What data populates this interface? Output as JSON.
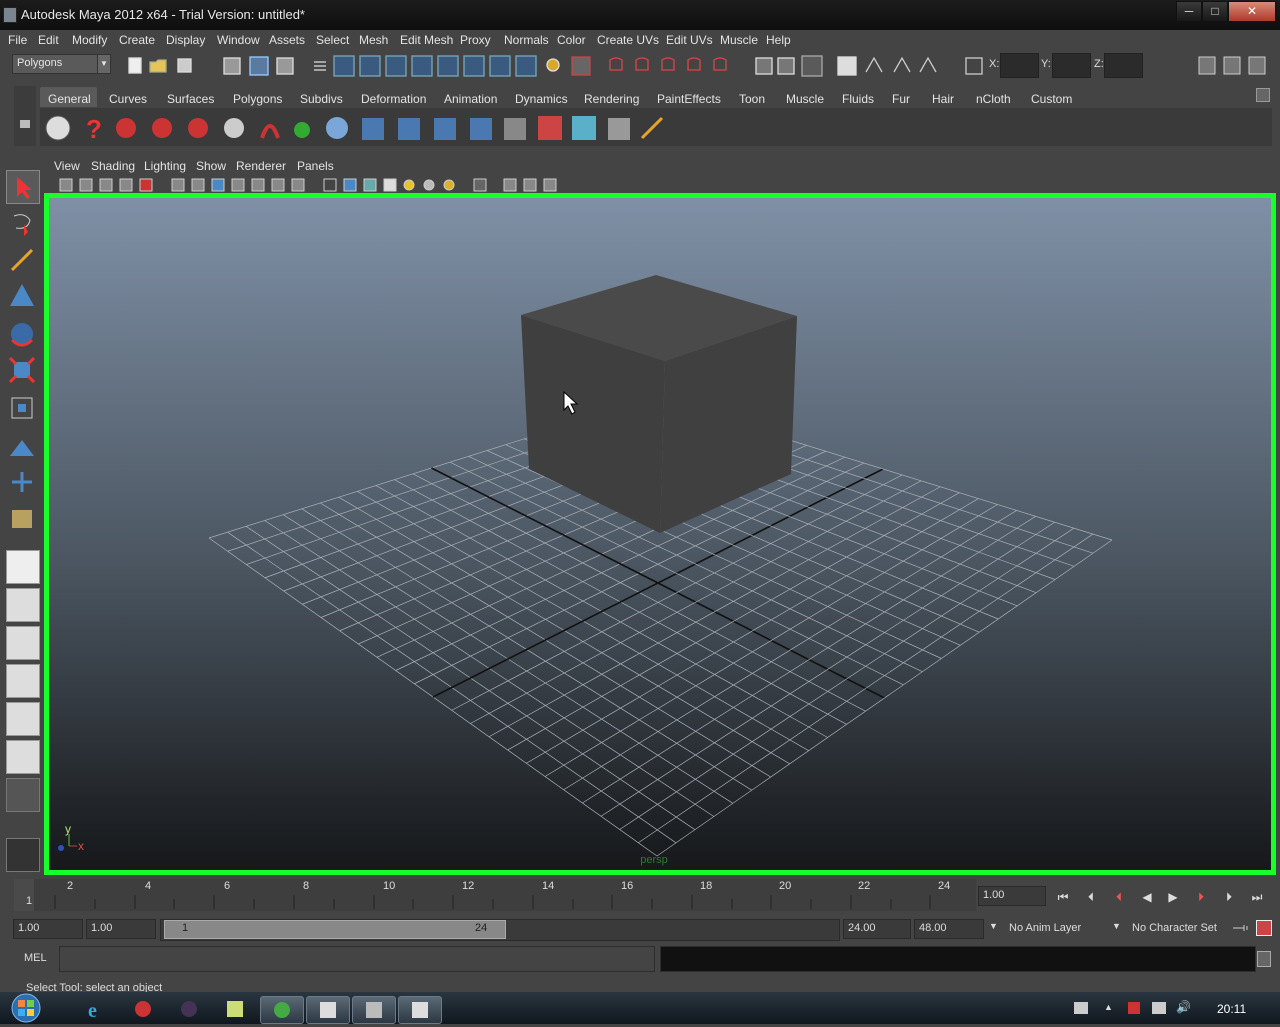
{
  "window": {
    "title": "Autodesk Maya 2012 x64 - Trial Version: untitled*",
    "minimize": "─",
    "maximize": "□",
    "close": "✕"
  },
  "menubar": [
    "File",
    "Edit",
    "Modify",
    "Create",
    "Display",
    "Window",
    "Assets",
    "Select",
    "Mesh",
    "Edit Mesh",
    "Proxy",
    "Normals",
    "Color",
    "Create UVs",
    "Edit UVs",
    "Muscle",
    "Help"
  ],
  "statusline": {
    "menu_set": "Polygons",
    "x_label": "X:",
    "y_label": "Y:",
    "z_label": "Z:"
  },
  "shelf": {
    "tabs": [
      "General",
      "Curves",
      "Surfaces",
      "Polygons",
      "Subdivs",
      "Deformation",
      "Animation",
      "Dynamics",
      "Rendering",
      "PaintEffects",
      "Toon",
      "Muscle",
      "Fluids",
      "Fur",
      "Hair",
      "nCloth",
      "Custom"
    ],
    "active_tab": "General"
  },
  "panel_menu": [
    "View",
    "Shading",
    "Lighting",
    "Show",
    "Renderer",
    "Panels"
  ],
  "viewport": {
    "camera_label": "persp",
    "axis_y": "y",
    "axis_x": "x"
  },
  "timeline": {
    "ticks": [
      "1",
      "2",
      "4",
      "6",
      "8",
      "10",
      "12",
      "14",
      "16",
      "18",
      "20",
      "22",
      "24"
    ],
    "current_frame": "1.00"
  },
  "range": {
    "start_min": "1.00",
    "start": "1.00",
    "slider_start": "1",
    "slider_end": "24",
    "end": "24.00",
    "end_max": "48.00",
    "anim_layer": "No Anim Layer",
    "character_set": "No Character Set"
  },
  "command_line": {
    "label": "MEL",
    "help": "Select Tool: select an object"
  },
  "taskbar": {
    "clock": "20:11"
  },
  "colors": {
    "viewport_border": "#19ff2a",
    "bg_top": "#7d8ea4",
    "bg_bottom": "#1a1c1e",
    "cube": "#454545"
  }
}
